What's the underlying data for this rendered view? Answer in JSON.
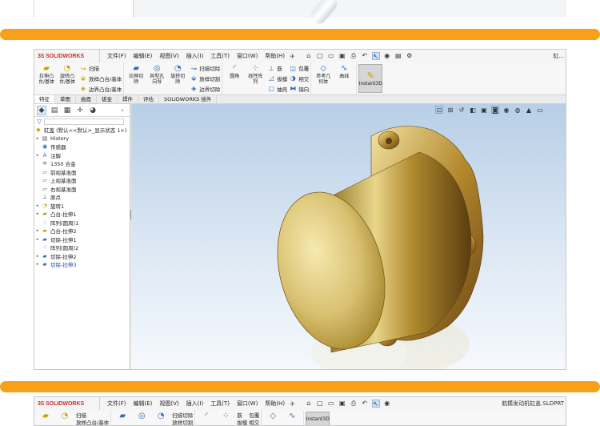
{
  "window": {
    "brand": "SOLIDWORKS",
    "brand_prefix": "3S",
    "title_right": "缸...",
    "title_right2": "航模发动机缸盖.SLDPRT"
  },
  "menus": [
    "文件(F)",
    "编辑(E)",
    "视图(V)",
    "插入(I)",
    "工具(T)",
    "窗口(W)",
    "帮助(H)"
  ],
  "quick_access": {
    "home_icon": "home-icon",
    "new_icon": "new-icon",
    "open_icon": "open-icon",
    "save_icon": "save-icon",
    "print_icon": "print-icon",
    "undo_icon": "undo-icon",
    "select_icon": "cursor-icon",
    "rebuild_icon": "rebuild-icon",
    "options_icon": "gear-icon"
  },
  "ribbon": {
    "extrude_boss": "拉伸凸\n台/基体",
    "revolve_boss": "旋转凸\n台/基体",
    "sweep": "扫描",
    "loft": "放样凸台/基体",
    "boundary_boss": "边界凸台/基体",
    "extrude_cut": "拉伸切\n除",
    "hole_wizard": "异型孔\n向导",
    "revolve_cut": "旋转切\n除",
    "sweep_cut": "扫描切除",
    "loft_cut": "放样切割",
    "boundary_cut": "边界切除",
    "fillet": "圆角",
    "linear_pattern": "线性阵\n列",
    "rib": "筋",
    "draft": "拔模",
    "shell": "抽壳",
    "wrap": "包覆",
    "intersect": "相交",
    "mirror": "镜向",
    "ref_geometry": "参考几\n何体",
    "curves": "曲线",
    "instant3d": "Instant3D"
  },
  "tabs": [
    "特征",
    "草图",
    "曲面",
    "钣金",
    "焊件",
    "评估",
    "SOLIDWORKS 插件"
  ],
  "feature_tree": {
    "root": "缸盖 (默认<<默认>_显示状态 1>)",
    "items": [
      {
        "label": "History",
        "icon": "history-icon",
        "expand": "▸",
        "blue": false
      },
      {
        "label": "传感器",
        "icon": "sensor-icon",
        "expand": "",
        "blue": false
      },
      {
        "label": "注解",
        "icon": "annotation-icon",
        "expand": "▸",
        "blue": false
      },
      {
        "label": "1350 合金",
        "icon": "material-icon",
        "expand": "",
        "blue": false
      },
      {
        "label": "前视基准面",
        "icon": "plane-icon",
        "expand": "",
        "blue": false
      },
      {
        "label": "上视基准面",
        "icon": "plane-icon",
        "expand": "",
        "blue": false
      },
      {
        "label": "右视基准面",
        "icon": "plane-icon",
        "expand": "",
        "blue": false
      },
      {
        "label": "原点",
        "icon": "origin-icon",
        "expand": "",
        "blue": false
      },
      {
        "label": "旋转1",
        "icon": "revolve-icon",
        "expand": "▸",
        "blue": false
      },
      {
        "label": "凸台-拉伸1",
        "icon": "extrude-icon",
        "expand": "▸",
        "blue": false
      },
      {
        "label": "阵列(圆周)1",
        "icon": "pattern-icon",
        "expand": "",
        "blue": false
      },
      {
        "label": "凸台-拉伸2",
        "icon": "extrude-icon",
        "expand": "▸",
        "blue": false
      },
      {
        "label": "切除-拉伸1",
        "icon": "cut-icon",
        "expand": "▸",
        "blue": false
      },
      {
        "label": "阵列(圆周)2",
        "icon": "pattern-icon",
        "expand": "",
        "blue": false
      },
      {
        "label": "切除-拉伸2",
        "icon": "cut-icon",
        "expand": "▸",
        "blue": false
      },
      {
        "label": "切除-拉伸3",
        "icon": "cut-icon",
        "expand": "▸",
        "blue": true
      }
    ]
  },
  "colors": {
    "accent_orange": "#f7a11b",
    "brand_red": "#d12b2b",
    "part_gold": "#c9a64a"
  }
}
